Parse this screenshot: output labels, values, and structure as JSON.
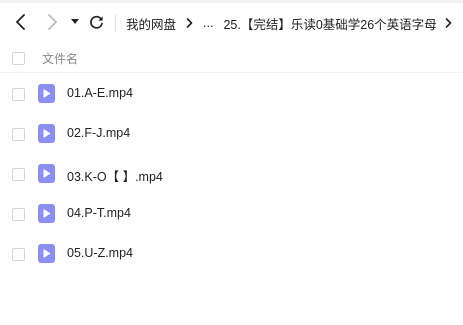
{
  "toolbar": {
    "back_icon": "chevron-left-icon",
    "forward_icon": "chevron-right-icon",
    "history_icon": "caret-down-icon",
    "refresh_icon": "refresh-icon"
  },
  "breadcrumb": {
    "root": "我的网盘",
    "ellipsis": "...",
    "current": "25.【完结】乐读0基础学26个英语字母"
  },
  "list_header": {
    "label": "文件名"
  },
  "files": [
    {
      "name": "01.A-E.mp4",
      "icon": "video-file-icon"
    },
    {
      "name": "02.F-J.mp4",
      "icon": "video-file-icon"
    },
    {
      "name": "03.K-O【 】.mp4",
      "icon": "video-file-icon"
    },
    {
      "name": "04.P-T.mp4",
      "icon": "video-file-icon"
    },
    {
      "name": "05.U-Z.mp4",
      "icon": "video-file-icon"
    }
  ],
  "colors": {
    "video_icon": "#8c8ff2",
    "checkbox_border": "#d6d6d6"
  }
}
